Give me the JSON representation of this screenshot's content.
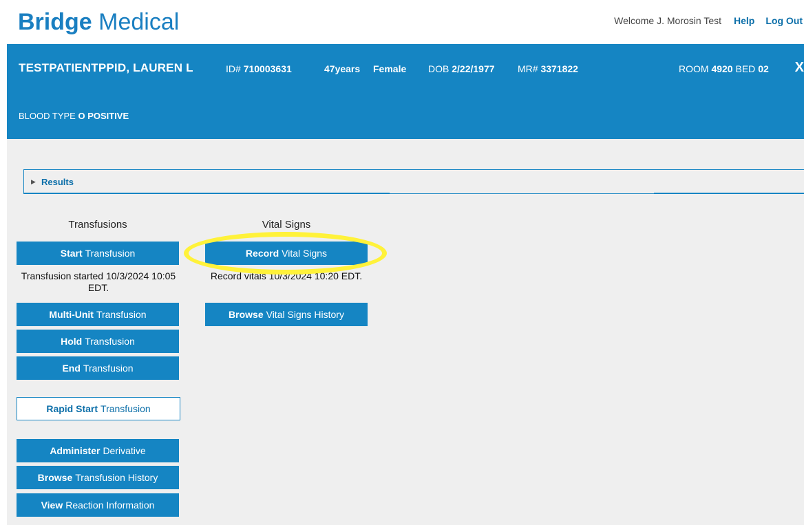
{
  "app": {
    "brand_bold": "Bridge",
    "brand_light": " Medical",
    "welcome": "Welcome J. Morosin Test",
    "help": "Help",
    "logout": "Log Out"
  },
  "patient": {
    "name": "TESTPATIENTPPID, LAUREN L",
    "id_label": "ID#",
    "id_value": "710003631",
    "age": "47years",
    "sex": "Female",
    "dob_label": "DOB",
    "dob_value": "2/22/1977",
    "mr_label": "MR#",
    "mr_value": "3371822",
    "room_label": "ROOM",
    "room_value": "4920",
    "bed_label": "BED",
    "bed_value": "02",
    "close": "X",
    "blood_label": "BLOOD TYPE",
    "blood_value": "O POSITIVE"
  },
  "results": {
    "label": "Results",
    "icon": "triangle-right-icon"
  },
  "transfusions": {
    "title": "Transfusions",
    "start": {
      "bold": "Start",
      "rest": "Transfusion"
    },
    "status": "Transfusion started 10/3/2024 10:05 EDT.",
    "multi": {
      "bold": "Multi-Unit",
      "rest": "Transfusion"
    },
    "hold": {
      "bold": "Hold",
      "rest": "Transfusion"
    },
    "end": {
      "bold": "End",
      "rest": "Transfusion"
    },
    "rapid": {
      "bold": "Rapid Start",
      "rest": "Transfusion"
    },
    "derivative": {
      "bold": "Administer",
      "rest": "Derivative"
    },
    "browse": {
      "bold": "Browse",
      "rest": "Transfusion History"
    },
    "reaction": {
      "bold": "View",
      "rest": "Reaction Information"
    }
  },
  "vitals": {
    "title": "Vital Signs",
    "record": {
      "bold": "Record",
      "rest": "Vital Signs"
    },
    "status": "Record vitals 10/3/2024 10:20 EDT.",
    "browse": {
      "bold": "Browse",
      "rest": "Vital Signs History"
    }
  },
  "colors": {
    "brand": "#1a7fc1",
    "band": "#1585c3",
    "highlight": "#fff23a"
  }
}
